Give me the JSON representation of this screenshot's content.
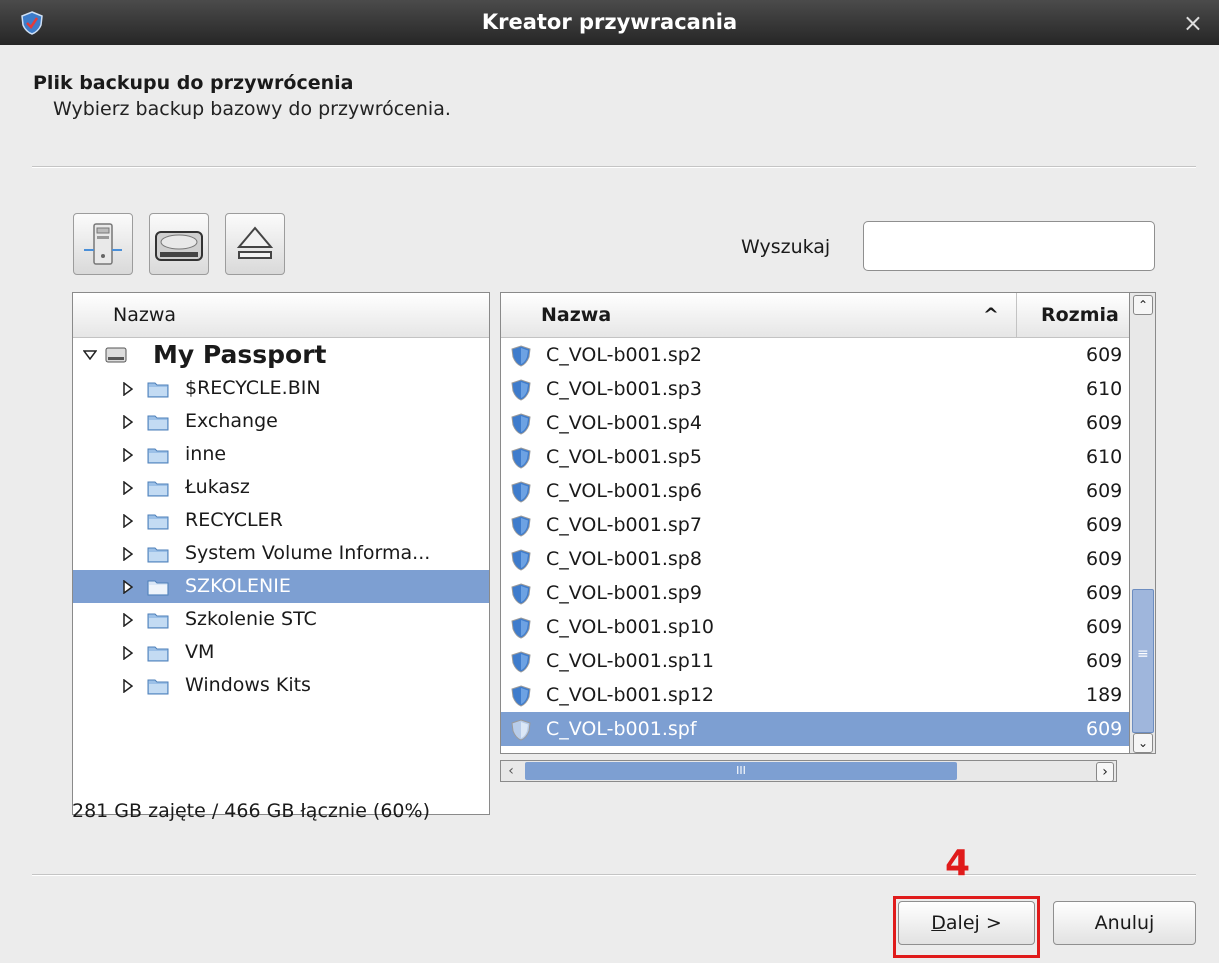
{
  "window": {
    "title": "Kreator przywracania",
    "close_glyph": "×"
  },
  "header": {
    "title": "Plik backupu do przywrócenia",
    "subtitle": "Wybierz backup bazowy do przywrócenia."
  },
  "toolbar": {
    "icons": [
      "network-computer-icon",
      "hard-drive-icon",
      "eject-icon"
    ]
  },
  "search": {
    "label": "Wyszukaj",
    "value": "",
    "icon": "search-icon"
  },
  "tree": {
    "column": "Nazwa",
    "root": "My Passport",
    "items": [
      {
        "label": "$RECYCLE.BIN"
      },
      {
        "label": "Exchange"
      },
      {
        "label": "inne"
      },
      {
        "label": "Łukasz"
      },
      {
        "label": "RECYCLER"
      },
      {
        "label": "System Volume Informa..."
      },
      {
        "label": "SZKOLENIE",
        "selected": true
      },
      {
        "label": "Szkolenie STC"
      },
      {
        "label": "VM"
      },
      {
        "label": "Windows Kits"
      }
    ]
  },
  "files": {
    "columns": {
      "name": "Nazwa",
      "sort_glyph": "^",
      "size": "Rozmia"
    },
    "rows": [
      {
        "name": "C_VOL-b001.sp2",
        "size": "609"
      },
      {
        "name": "C_VOL-b001.sp3",
        "size": "610"
      },
      {
        "name": "C_VOL-b001.sp4",
        "size": "609"
      },
      {
        "name": "C_VOL-b001.sp5",
        "size": "610"
      },
      {
        "name": "C_VOL-b001.sp6",
        "size": "609"
      },
      {
        "name": "C_VOL-b001.sp7",
        "size": "609"
      },
      {
        "name": "C_VOL-b001.sp8",
        "size": "609"
      },
      {
        "name": "C_VOL-b001.sp9",
        "size": "609"
      },
      {
        "name": "C_VOL-b001.sp10",
        "size": "609"
      },
      {
        "name": "C_VOL-b001.sp11",
        "size": "609"
      },
      {
        "name": "C_VOL-b001.sp12",
        "size": "189"
      },
      {
        "name": "C_VOL-b001.spf",
        "size": "609",
        "selected": true
      }
    ],
    "hscroll_thumb": "III",
    "vscroll_grip": "≡"
  },
  "status": "281 GB zajęte / 466 GB łącznie (60%)",
  "annotation": "4",
  "buttons": {
    "next_mnemonic": "D",
    "next_rest": "alej >",
    "cancel": "Anuluj"
  },
  "colors": {
    "selection": "#7d9fd2",
    "annotation": "#e01b1b",
    "titlebar": "#3a3a3a"
  }
}
